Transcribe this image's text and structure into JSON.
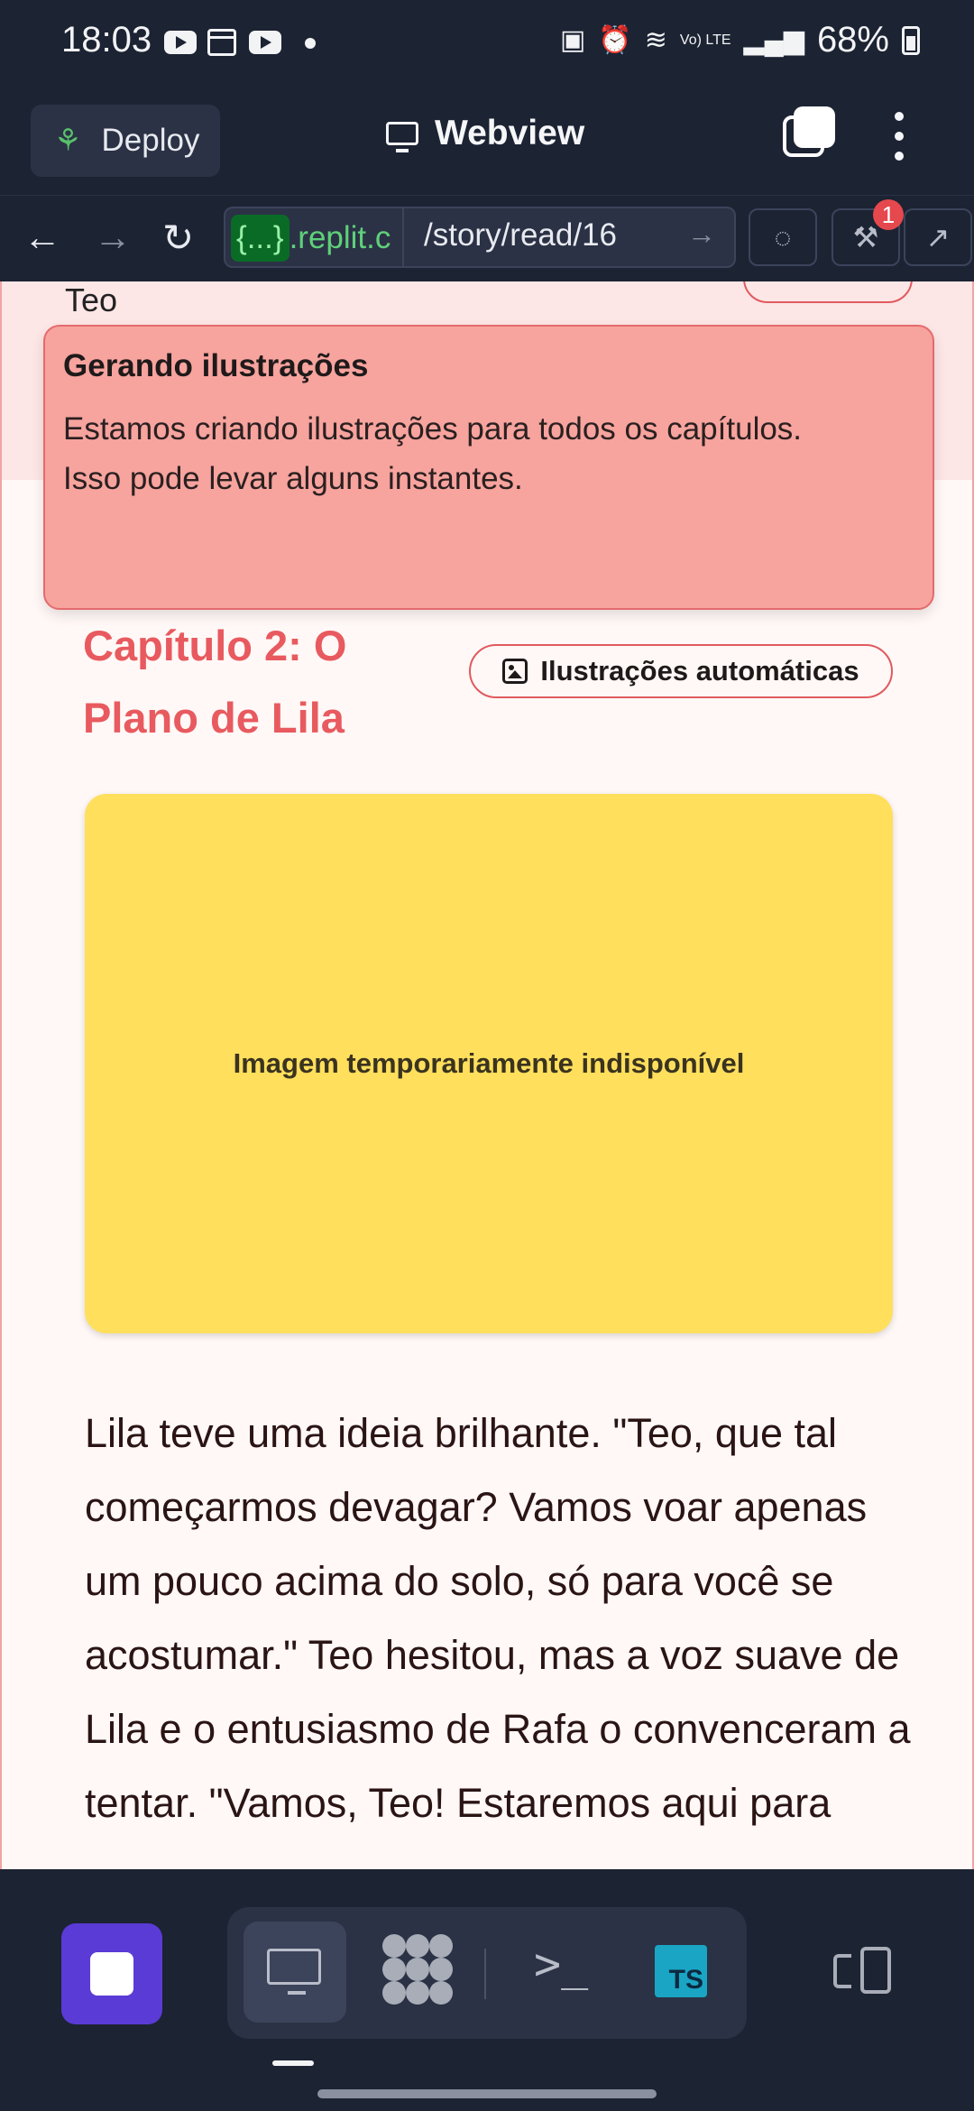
{
  "status_bar": {
    "time": "18:03",
    "signal_labels": "Vo) LTE",
    "battery": "68%"
  },
  "header": {
    "deploy_label": "Deploy",
    "title": "Webview"
  },
  "browser": {
    "url_chip": "{...}",
    "url_host": ".replit.c",
    "url_path": "/story/read/16",
    "devtools_badge": "1"
  },
  "page": {
    "top_name": "Teo",
    "toast": {
      "title": "Gerando ilustrações",
      "description": "Estamos criando ilustrações para todos os capítulos. Isso pode levar alguns instantes."
    },
    "chapter_title": "Capítulo 2: O Plano de Lila",
    "auto_illustrations_label": "Ilustrações automáticas",
    "image_placeholder": "Imagem temporariamente indisponível",
    "story_text": "Lila teve uma ideia brilhante. \"Teo, que tal começarmos devagar? Vamos voar apenas um pouco acima do solo, só para você se acostumar.\" Teo hesitou, mas a voz suave de Lila e o entusiasmo de Rafa o convenceram a tentar. \"Vamos, Teo! Estaremos aqui para"
  },
  "bottom_bar": {
    "shell_symbol": ">_",
    "ts_label": "TS"
  },
  "colors": {
    "accent_red": "#e85a5f",
    "toast_bg": "#f7a39e",
    "placeholder_bg": "#ffdf5c",
    "stop_purple": "#5a3bd6"
  }
}
